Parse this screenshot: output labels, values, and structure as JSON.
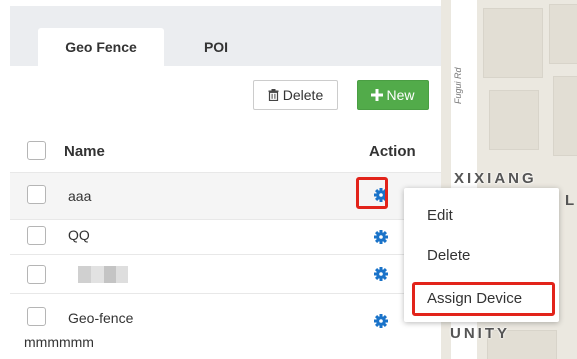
{
  "tabs": [
    {
      "label": "Geo Fence",
      "active": true
    },
    {
      "label": "POI",
      "active": false
    }
  ],
  "toolbar": {
    "delete_label": "Delete",
    "new_label": "New"
  },
  "table": {
    "columns": {
      "name": "Name",
      "action": "Action"
    },
    "rows": [
      {
        "name": "aaa"
      },
      {
        "name": "QQ"
      },
      {
        "name": ""
      },
      {
        "name_line1": "Geo-fence",
        "name_line2": "mmmmmm"
      }
    ]
  },
  "action_menu": {
    "items": [
      "Edit",
      "Delete",
      "Assign Device"
    ],
    "highlighted": "Assign Device"
  },
  "map": {
    "road_label": "Fugui Rd",
    "district_top": "XIXIANG",
    "district_bottom": "UNITY",
    "edge_letter": "L"
  },
  "colors": {
    "accent_green": "#52ab4a",
    "gear_blue": "#1a73c9",
    "highlight_red": "#e2231a"
  },
  "icons": {
    "delete": "trash-icon",
    "new": "plus-icon",
    "action": "gear-icon"
  }
}
